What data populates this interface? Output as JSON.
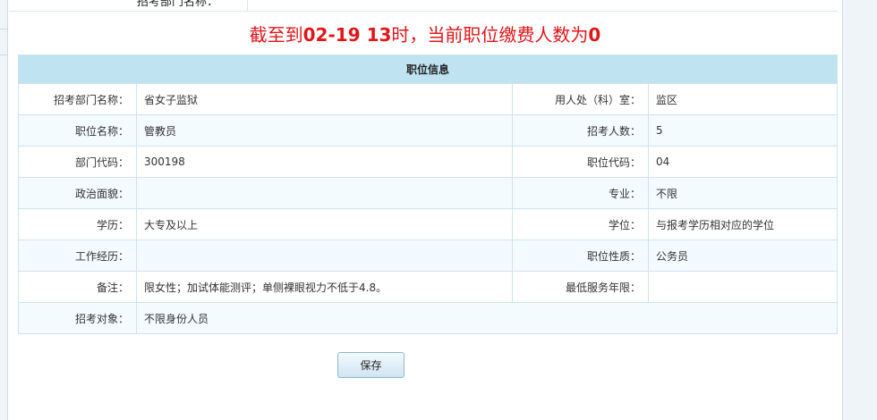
{
  "header": {
    "clipped_text": "招考部门名称："
  },
  "banner": {
    "prefix": "截至到",
    "date": "02-19",
    "space": " ",
    "hour": "13",
    "middle": "时，当前职位缴费人数为",
    "count": "0"
  },
  "table": {
    "title": "职位信息",
    "rows": [
      {
        "l1": "招考部门名称：",
        "v1": "省女子监狱",
        "l2": "用人处（科）室：",
        "v2": "监区"
      },
      {
        "l1": "职位名称：",
        "v1": "管教员",
        "l2": "招考人数：",
        "v2": "5"
      },
      {
        "l1": "部门代码：",
        "v1": "300198",
        "l2": "职位代码：",
        "v2": "04"
      },
      {
        "l1": "政治面貌：",
        "v1": "",
        "l2": "专业：",
        "v2": "不限"
      },
      {
        "l1": "学历：",
        "v1": "大专及以上",
        "l2": "学位：",
        "v2": "与报考学历相对应的学位"
      },
      {
        "l1": "工作经历：",
        "v1": "",
        "l2": "职位性质：",
        "v2": "公务员"
      },
      {
        "l1": "备注：",
        "v1": "限女性；加试体能测评；单侧裸眼视力不低于4.8。",
        "l2": "最低服务年限：",
        "v2": ""
      }
    ],
    "last_row": {
      "l1": "招考对象：",
      "v1": "不限身份人员"
    }
  },
  "actions": {
    "save_label": "保存"
  }
}
